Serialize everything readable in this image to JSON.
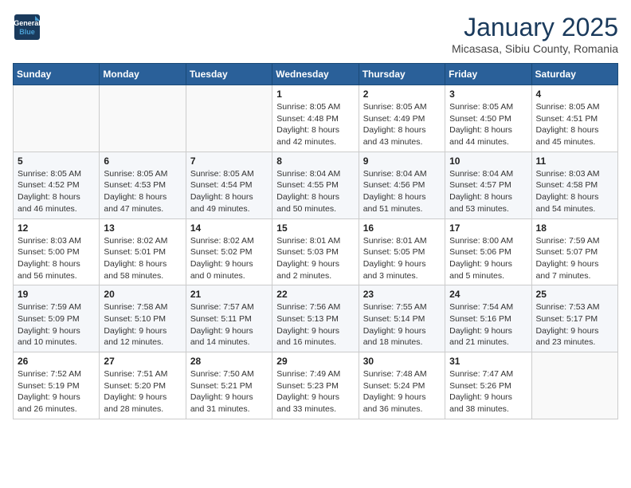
{
  "logo": {
    "line1": "General",
    "line2": "Blue"
  },
  "title": "January 2025",
  "location": "Micasasa, Sibiu County, Romania",
  "weekdays": [
    "Sunday",
    "Monday",
    "Tuesday",
    "Wednesday",
    "Thursday",
    "Friday",
    "Saturday"
  ],
  "weeks": [
    [
      {
        "day": "",
        "info": ""
      },
      {
        "day": "",
        "info": ""
      },
      {
        "day": "",
        "info": ""
      },
      {
        "day": "1",
        "info": "Sunrise: 8:05 AM\nSunset: 4:48 PM\nDaylight: 8 hours and 42 minutes."
      },
      {
        "day": "2",
        "info": "Sunrise: 8:05 AM\nSunset: 4:49 PM\nDaylight: 8 hours and 43 minutes."
      },
      {
        "day": "3",
        "info": "Sunrise: 8:05 AM\nSunset: 4:50 PM\nDaylight: 8 hours and 44 minutes."
      },
      {
        "day": "4",
        "info": "Sunrise: 8:05 AM\nSunset: 4:51 PM\nDaylight: 8 hours and 45 minutes."
      }
    ],
    [
      {
        "day": "5",
        "info": "Sunrise: 8:05 AM\nSunset: 4:52 PM\nDaylight: 8 hours and 46 minutes."
      },
      {
        "day": "6",
        "info": "Sunrise: 8:05 AM\nSunset: 4:53 PM\nDaylight: 8 hours and 47 minutes."
      },
      {
        "day": "7",
        "info": "Sunrise: 8:05 AM\nSunset: 4:54 PM\nDaylight: 8 hours and 49 minutes."
      },
      {
        "day": "8",
        "info": "Sunrise: 8:04 AM\nSunset: 4:55 PM\nDaylight: 8 hours and 50 minutes."
      },
      {
        "day": "9",
        "info": "Sunrise: 8:04 AM\nSunset: 4:56 PM\nDaylight: 8 hours and 51 minutes."
      },
      {
        "day": "10",
        "info": "Sunrise: 8:04 AM\nSunset: 4:57 PM\nDaylight: 8 hours and 53 minutes."
      },
      {
        "day": "11",
        "info": "Sunrise: 8:03 AM\nSunset: 4:58 PM\nDaylight: 8 hours and 54 minutes."
      }
    ],
    [
      {
        "day": "12",
        "info": "Sunrise: 8:03 AM\nSunset: 5:00 PM\nDaylight: 8 hours and 56 minutes."
      },
      {
        "day": "13",
        "info": "Sunrise: 8:02 AM\nSunset: 5:01 PM\nDaylight: 8 hours and 58 minutes."
      },
      {
        "day": "14",
        "info": "Sunrise: 8:02 AM\nSunset: 5:02 PM\nDaylight: 9 hours and 0 minutes."
      },
      {
        "day": "15",
        "info": "Sunrise: 8:01 AM\nSunset: 5:03 PM\nDaylight: 9 hours and 2 minutes."
      },
      {
        "day": "16",
        "info": "Sunrise: 8:01 AM\nSunset: 5:05 PM\nDaylight: 9 hours and 3 minutes."
      },
      {
        "day": "17",
        "info": "Sunrise: 8:00 AM\nSunset: 5:06 PM\nDaylight: 9 hours and 5 minutes."
      },
      {
        "day": "18",
        "info": "Sunrise: 7:59 AM\nSunset: 5:07 PM\nDaylight: 9 hours and 7 minutes."
      }
    ],
    [
      {
        "day": "19",
        "info": "Sunrise: 7:59 AM\nSunset: 5:09 PM\nDaylight: 9 hours and 10 minutes."
      },
      {
        "day": "20",
        "info": "Sunrise: 7:58 AM\nSunset: 5:10 PM\nDaylight: 9 hours and 12 minutes."
      },
      {
        "day": "21",
        "info": "Sunrise: 7:57 AM\nSunset: 5:11 PM\nDaylight: 9 hours and 14 minutes."
      },
      {
        "day": "22",
        "info": "Sunrise: 7:56 AM\nSunset: 5:13 PM\nDaylight: 9 hours and 16 minutes."
      },
      {
        "day": "23",
        "info": "Sunrise: 7:55 AM\nSunset: 5:14 PM\nDaylight: 9 hours and 18 minutes."
      },
      {
        "day": "24",
        "info": "Sunrise: 7:54 AM\nSunset: 5:16 PM\nDaylight: 9 hours and 21 minutes."
      },
      {
        "day": "25",
        "info": "Sunrise: 7:53 AM\nSunset: 5:17 PM\nDaylight: 9 hours and 23 minutes."
      }
    ],
    [
      {
        "day": "26",
        "info": "Sunrise: 7:52 AM\nSunset: 5:19 PM\nDaylight: 9 hours and 26 minutes."
      },
      {
        "day": "27",
        "info": "Sunrise: 7:51 AM\nSunset: 5:20 PM\nDaylight: 9 hours and 28 minutes."
      },
      {
        "day": "28",
        "info": "Sunrise: 7:50 AM\nSunset: 5:21 PM\nDaylight: 9 hours and 31 minutes."
      },
      {
        "day": "29",
        "info": "Sunrise: 7:49 AM\nSunset: 5:23 PM\nDaylight: 9 hours and 33 minutes."
      },
      {
        "day": "30",
        "info": "Sunrise: 7:48 AM\nSunset: 5:24 PM\nDaylight: 9 hours and 36 minutes."
      },
      {
        "day": "31",
        "info": "Sunrise: 7:47 AM\nSunset: 5:26 PM\nDaylight: 9 hours and 38 minutes."
      },
      {
        "day": "",
        "info": ""
      }
    ]
  ]
}
